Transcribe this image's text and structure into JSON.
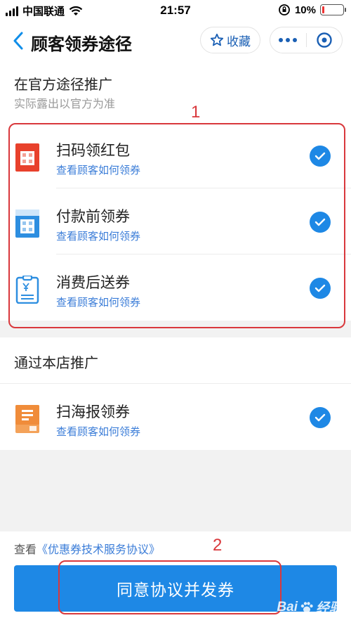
{
  "status_bar": {
    "carrier": "中国联通",
    "time": "21:57",
    "battery_text": "10%"
  },
  "nav": {
    "title": "顾客领券途径",
    "collect_label": "收藏"
  },
  "section_official": {
    "title": "在官方途径推广",
    "subtitle": "实际露出以官方为准",
    "items": [
      {
        "title": "扫码领红包",
        "link": "查看顾客如何领券",
        "icon": "red-qr-icon",
        "checked": true
      },
      {
        "title": "付款前领券",
        "link": "查看顾客如何领券",
        "icon": "blue-qr-icon",
        "checked": true
      },
      {
        "title": "消费后送券",
        "link": "查看顾客如何领券",
        "icon": "receipt-icon",
        "checked": true
      }
    ]
  },
  "section_store": {
    "title": "通过本店推广",
    "items": [
      {
        "title": "扫海报领券",
        "link": "查看顾客如何领券",
        "icon": "poster-icon",
        "checked": true
      }
    ]
  },
  "footer": {
    "agreement_prefix": "查看",
    "agreement_link": "《优惠券技术服务协议》",
    "submit_label": "同意协议并发券"
  },
  "annotations": {
    "label1": "1",
    "label2": "2"
  },
  "watermark": {
    "text": "Bai",
    "text2": "经验"
  },
  "colors": {
    "accent": "#1e88e5",
    "link": "#3b7dd8",
    "annotation": "#d9383c"
  }
}
